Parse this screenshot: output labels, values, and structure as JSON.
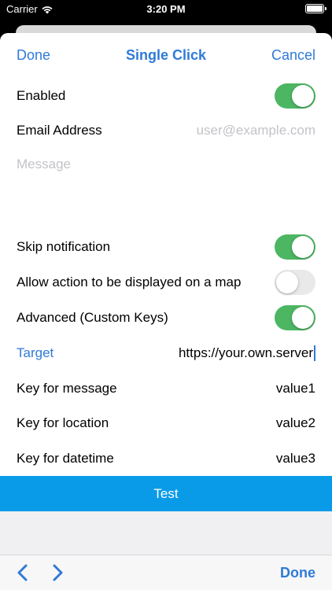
{
  "status_bar": {
    "carrier": "Carrier",
    "time": "3:20 PM",
    "wifi_icon": "wifi-icon",
    "battery_icon": "battery-icon"
  },
  "nav": {
    "done": "Done",
    "title": "Single Click",
    "cancel": "Cancel"
  },
  "form": {
    "enabled": {
      "label": "Enabled",
      "on": true
    },
    "email": {
      "label": "Email Address",
      "placeholder": "user@example.com"
    },
    "message": {
      "placeholder": "Message"
    },
    "skip_notification": {
      "label": "Skip notification",
      "on": true
    },
    "allow_map": {
      "label": "Allow action to be displayed on a map",
      "on": false
    },
    "advanced": {
      "label": "Advanced (Custom Keys)",
      "on": true
    },
    "target": {
      "label": "Target",
      "value": "https://your.own.server"
    },
    "key_message": {
      "label": "Key for message",
      "value": "value1"
    },
    "key_location": {
      "label": "Key for location",
      "value": "value2"
    },
    "key_datetime": {
      "label": "Key for datetime",
      "value": "value3"
    }
  },
  "test_button": {
    "label": "Test"
  },
  "toolbar": {
    "done": "Done",
    "prev_icon": "chevron-left-icon",
    "next_icon": "chevron-right-icon"
  },
  "colors": {
    "accent": "#2f7ad8",
    "toggle_on": "#4cb663",
    "test_button": "#0a9be8"
  }
}
